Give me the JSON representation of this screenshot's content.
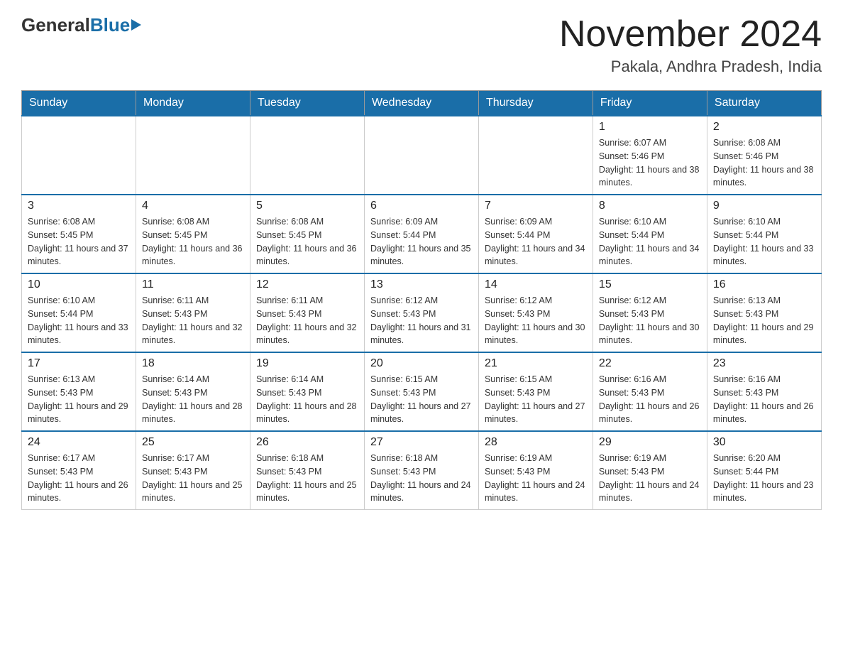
{
  "header": {
    "logo_general": "General",
    "logo_blue": "Blue",
    "month_title": "November 2024",
    "location": "Pakala, Andhra Pradesh, India"
  },
  "weekdays": [
    "Sunday",
    "Monday",
    "Tuesday",
    "Wednesday",
    "Thursday",
    "Friday",
    "Saturday"
  ],
  "weeks": [
    [
      {
        "day": "",
        "info": ""
      },
      {
        "day": "",
        "info": ""
      },
      {
        "day": "",
        "info": ""
      },
      {
        "day": "",
        "info": ""
      },
      {
        "day": "",
        "info": ""
      },
      {
        "day": "1",
        "info": "Sunrise: 6:07 AM\nSunset: 5:46 PM\nDaylight: 11 hours and 38 minutes."
      },
      {
        "day": "2",
        "info": "Sunrise: 6:08 AM\nSunset: 5:46 PM\nDaylight: 11 hours and 38 minutes."
      }
    ],
    [
      {
        "day": "3",
        "info": "Sunrise: 6:08 AM\nSunset: 5:45 PM\nDaylight: 11 hours and 37 minutes."
      },
      {
        "day": "4",
        "info": "Sunrise: 6:08 AM\nSunset: 5:45 PM\nDaylight: 11 hours and 36 minutes."
      },
      {
        "day": "5",
        "info": "Sunrise: 6:08 AM\nSunset: 5:45 PM\nDaylight: 11 hours and 36 minutes."
      },
      {
        "day": "6",
        "info": "Sunrise: 6:09 AM\nSunset: 5:44 PM\nDaylight: 11 hours and 35 minutes."
      },
      {
        "day": "7",
        "info": "Sunrise: 6:09 AM\nSunset: 5:44 PM\nDaylight: 11 hours and 34 minutes."
      },
      {
        "day": "8",
        "info": "Sunrise: 6:10 AM\nSunset: 5:44 PM\nDaylight: 11 hours and 34 minutes."
      },
      {
        "day": "9",
        "info": "Sunrise: 6:10 AM\nSunset: 5:44 PM\nDaylight: 11 hours and 33 minutes."
      }
    ],
    [
      {
        "day": "10",
        "info": "Sunrise: 6:10 AM\nSunset: 5:44 PM\nDaylight: 11 hours and 33 minutes."
      },
      {
        "day": "11",
        "info": "Sunrise: 6:11 AM\nSunset: 5:43 PM\nDaylight: 11 hours and 32 minutes."
      },
      {
        "day": "12",
        "info": "Sunrise: 6:11 AM\nSunset: 5:43 PM\nDaylight: 11 hours and 32 minutes."
      },
      {
        "day": "13",
        "info": "Sunrise: 6:12 AM\nSunset: 5:43 PM\nDaylight: 11 hours and 31 minutes."
      },
      {
        "day": "14",
        "info": "Sunrise: 6:12 AM\nSunset: 5:43 PM\nDaylight: 11 hours and 30 minutes."
      },
      {
        "day": "15",
        "info": "Sunrise: 6:12 AM\nSunset: 5:43 PM\nDaylight: 11 hours and 30 minutes."
      },
      {
        "day": "16",
        "info": "Sunrise: 6:13 AM\nSunset: 5:43 PM\nDaylight: 11 hours and 29 minutes."
      }
    ],
    [
      {
        "day": "17",
        "info": "Sunrise: 6:13 AM\nSunset: 5:43 PM\nDaylight: 11 hours and 29 minutes."
      },
      {
        "day": "18",
        "info": "Sunrise: 6:14 AM\nSunset: 5:43 PM\nDaylight: 11 hours and 28 minutes."
      },
      {
        "day": "19",
        "info": "Sunrise: 6:14 AM\nSunset: 5:43 PM\nDaylight: 11 hours and 28 minutes."
      },
      {
        "day": "20",
        "info": "Sunrise: 6:15 AM\nSunset: 5:43 PM\nDaylight: 11 hours and 27 minutes."
      },
      {
        "day": "21",
        "info": "Sunrise: 6:15 AM\nSunset: 5:43 PM\nDaylight: 11 hours and 27 minutes."
      },
      {
        "day": "22",
        "info": "Sunrise: 6:16 AM\nSunset: 5:43 PM\nDaylight: 11 hours and 26 minutes."
      },
      {
        "day": "23",
        "info": "Sunrise: 6:16 AM\nSunset: 5:43 PM\nDaylight: 11 hours and 26 minutes."
      }
    ],
    [
      {
        "day": "24",
        "info": "Sunrise: 6:17 AM\nSunset: 5:43 PM\nDaylight: 11 hours and 26 minutes."
      },
      {
        "day": "25",
        "info": "Sunrise: 6:17 AM\nSunset: 5:43 PM\nDaylight: 11 hours and 25 minutes."
      },
      {
        "day": "26",
        "info": "Sunrise: 6:18 AM\nSunset: 5:43 PM\nDaylight: 11 hours and 25 minutes."
      },
      {
        "day": "27",
        "info": "Sunrise: 6:18 AM\nSunset: 5:43 PM\nDaylight: 11 hours and 24 minutes."
      },
      {
        "day": "28",
        "info": "Sunrise: 6:19 AM\nSunset: 5:43 PM\nDaylight: 11 hours and 24 minutes."
      },
      {
        "day": "29",
        "info": "Sunrise: 6:19 AM\nSunset: 5:43 PM\nDaylight: 11 hours and 24 minutes."
      },
      {
        "day": "30",
        "info": "Sunrise: 6:20 AM\nSunset: 5:44 PM\nDaylight: 11 hours and 23 minutes."
      }
    ]
  ]
}
